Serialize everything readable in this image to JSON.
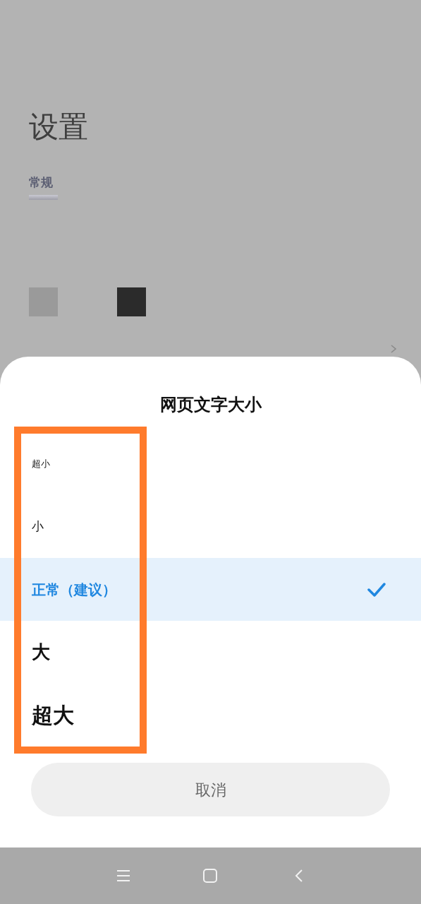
{
  "background": {
    "title": "设置",
    "section": "常规",
    "swatches": [
      {
        "color": "#9a9a9a"
      },
      {
        "color": "#2b2b2b"
      }
    ]
  },
  "sheet": {
    "title": "网页文字大小",
    "options": [
      {
        "label": "超小",
        "selected": false
      },
      {
        "label": "小",
        "selected": false
      },
      {
        "label": "正常（建议）",
        "selected": true
      },
      {
        "label": "大",
        "selected": false
      },
      {
        "label": "超大",
        "selected": false
      }
    ],
    "cancel": "取消"
  }
}
